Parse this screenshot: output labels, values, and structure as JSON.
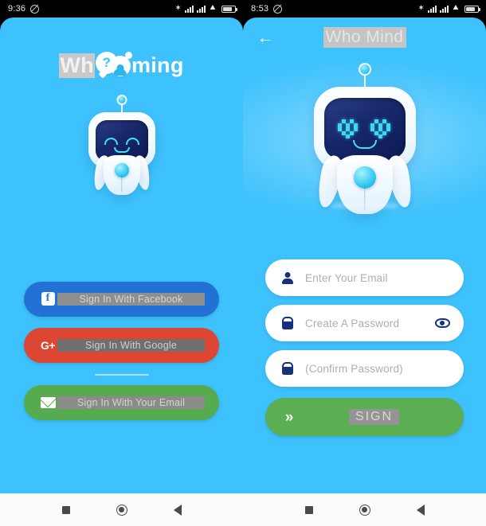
{
  "app": {
    "brand_blue": "#3ec2fd",
    "accent_green": "#55ab4e",
    "facebook_blue": "#2272d6",
    "google_red": "#dd4632",
    "navy": "#16307c"
  },
  "left_device": {
    "statusbar": {
      "time": "9:36",
      "mute_icon": "mute-icon",
      "bluetooth": "✶",
      "signal1": "signal-bars-icon",
      "signal2": "signal-bars-icon",
      "wifi": "wifi-icon",
      "battery": "battery-icon"
    },
    "logo": {
      "part1": "Wh",
      "badge_question": "?",
      "part2": "ming",
      "full_text": "Whooming"
    },
    "mascot": {
      "name": "robot-mascot",
      "expression": "happy-arc-eyes"
    },
    "buttons": [
      {
        "id": "facebook",
        "label": "Sign In With Facebook",
        "icon": "facebook-icon",
        "color": "#2272d6"
      },
      {
        "id": "google",
        "label": "Sign In With Google",
        "icon": "google-plus-icon",
        "color": "#dd4632"
      },
      {
        "id": "email",
        "label": "Sign In With Your Email",
        "icon": "envelope-icon",
        "color": "#55ab4e"
      }
    ],
    "navbar": {
      "recents": "square-icon",
      "home": "circle-icon",
      "back": "triangle-left-icon"
    }
  },
  "right_device": {
    "statusbar": {
      "time": "8:53",
      "mute_icon": "mute-icon",
      "bluetooth": "✶",
      "wifi": "wifi-icon",
      "battery": "battery-icon"
    },
    "header": {
      "back_icon": "←",
      "title": "Who Mind"
    },
    "mascot": {
      "name": "robot-mascot",
      "expression": "heart-eyes"
    },
    "fields": [
      {
        "id": "email",
        "placeholder": "Enter Your Email",
        "icon": "user-icon",
        "trailing": ""
      },
      {
        "id": "password",
        "placeholder": "Create A Password",
        "icon": "lock-icon",
        "trailing": "eye-icon"
      },
      {
        "id": "confirm",
        "placeholder": "(Confirm Password)",
        "icon": "lock-icon",
        "trailing": ""
      }
    ],
    "submit": {
      "label": "SIGN",
      "icon": "»",
      "color": "#5cae52"
    },
    "navbar": {
      "recents": "square-icon",
      "home": "circle-icon",
      "back": "triangle-left-icon"
    }
  }
}
